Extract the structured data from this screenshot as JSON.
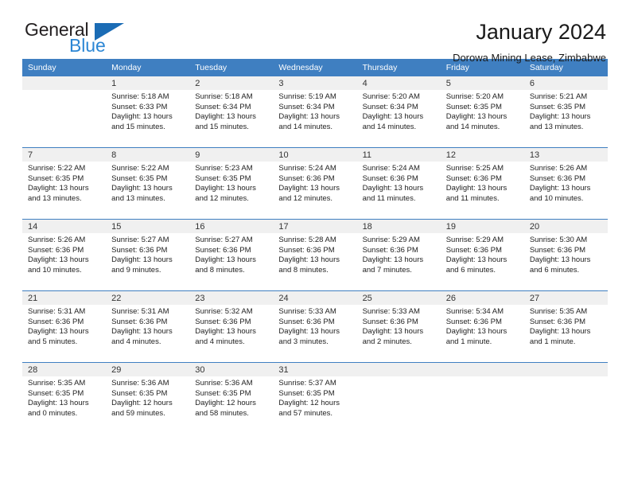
{
  "brand": {
    "name_part1": "General",
    "name_part2": "Blue",
    "triangle_icon": "triangle-icon",
    "accent_dark": "#231f20",
    "accent_blue": "#2b86d4",
    "triangle_blue": "#1b6cb5"
  },
  "header": {
    "title": "January 2024",
    "subtitle": "Dorowa Mining Lease, Zimbabwe"
  },
  "calendar": {
    "header_bg": "#3f7fc1",
    "daynum_bg": "#f0f0f0",
    "weekday_headers": [
      "Sunday",
      "Monday",
      "Tuesday",
      "Wednesday",
      "Thursday",
      "Friday",
      "Saturday"
    ],
    "weeks": [
      [
        {
          "day": "",
          "empty": true,
          "sunrise": "",
          "sunset": "",
          "daylight1": "",
          "daylight2": ""
        },
        {
          "day": "1",
          "sunrise": "Sunrise: 5:18 AM",
          "sunset": "Sunset: 6:33 PM",
          "daylight1": "Daylight: 13 hours",
          "daylight2": "and 15 minutes."
        },
        {
          "day": "2",
          "sunrise": "Sunrise: 5:18 AM",
          "sunset": "Sunset: 6:34 PM",
          "daylight1": "Daylight: 13 hours",
          "daylight2": "and 15 minutes."
        },
        {
          "day": "3",
          "sunrise": "Sunrise: 5:19 AM",
          "sunset": "Sunset: 6:34 PM",
          "daylight1": "Daylight: 13 hours",
          "daylight2": "and 14 minutes."
        },
        {
          "day": "4",
          "sunrise": "Sunrise: 5:20 AM",
          "sunset": "Sunset: 6:34 PM",
          "daylight1": "Daylight: 13 hours",
          "daylight2": "and 14 minutes."
        },
        {
          "day": "5",
          "sunrise": "Sunrise: 5:20 AM",
          "sunset": "Sunset: 6:35 PM",
          "daylight1": "Daylight: 13 hours",
          "daylight2": "and 14 minutes."
        },
        {
          "day": "6",
          "sunrise": "Sunrise: 5:21 AM",
          "sunset": "Sunset: 6:35 PM",
          "daylight1": "Daylight: 13 hours",
          "daylight2": "and 13 minutes."
        }
      ],
      [
        {
          "day": "7",
          "sunrise": "Sunrise: 5:22 AM",
          "sunset": "Sunset: 6:35 PM",
          "daylight1": "Daylight: 13 hours",
          "daylight2": "and 13 minutes."
        },
        {
          "day": "8",
          "sunrise": "Sunrise: 5:22 AM",
          "sunset": "Sunset: 6:35 PM",
          "daylight1": "Daylight: 13 hours",
          "daylight2": "and 13 minutes."
        },
        {
          "day": "9",
          "sunrise": "Sunrise: 5:23 AM",
          "sunset": "Sunset: 6:35 PM",
          "daylight1": "Daylight: 13 hours",
          "daylight2": "and 12 minutes."
        },
        {
          "day": "10",
          "sunrise": "Sunrise: 5:24 AM",
          "sunset": "Sunset: 6:36 PM",
          "daylight1": "Daylight: 13 hours",
          "daylight2": "and 12 minutes."
        },
        {
          "day": "11",
          "sunrise": "Sunrise: 5:24 AM",
          "sunset": "Sunset: 6:36 PM",
          "daylight1": "Daylight: 13 hours",
          "daylight2": "and 11 minutes."
        },
        {
          "day": "12",
          "sunrise": "Sunrise: 5:25 AM",
          "sunset": "Sunset: 6:36 PM",
          "daylight1": "Daylight: 13 hours",
          "daylight2": "and 11 minutes."
        },
        {
          "day": "13",
          "sunrise": "Sunrise: 5:26 AM",
          "sunset": "Sunset: 6:36 PM",
          "daylight1": "Daylight: 13 hours",
          "daylight2": "and 10 minutes."
        }
      ],
      [
        {
          "day": "14",
          "sunrise": "Sunrise: 5:26 AM",
          "sunset": "Sunset: 6:36 PM",
          "daylight1": "Daylight: 13 hours",
          "daylight2": "and 10 minutes."
        },
        {
          "day": "15",
          "sunrise": "Sunrise: 5:27 AM",
          "sunset": "Sunset: 6:36 PM",
          "daylight1": "Daylight: 13 hours",
          "daylight2": "and 9 minutes."
        },
        {
          "day": "16",
          "sunrise": "Sunrise: 5:27 AM",
          "sunset": "Sunset: 6:36 PM",
          "daylight1": "Daylight: 13 hours",
          "daylight2": "and 8 minutes."
        },
        {
          "day": "17",
          "sunrise": "Sunrise: 5:28 AM",
          "sunset": "Sunset: 6:36 PM",
          "daylight1": "Daylight: 13 hours",
          "daylight2": "and 8 minutes."
        },
        {
          "day": "18",
          "sunrise": "Sunrise: 5:29 AM",
          "sunset": "Sunset: 6:36 PM",
          "daylight1": "Daylight: 13 hours",
          "daylight2": "and 7 minutes."
        },
        {
          "day": "19",
          "sunrise": "Sunrise: 5:29 AM",
          "sunset": "Sunset: 6:36 PM",
          "daylight1": "Daylight: 13 hours",
          "daylight2": "and 6 minutes."
        },
        {
          "day": "20",
          "sunrise": "Sunrise: 5:30 AM",
          "sunset": "Sunset: 6:36 PM",
          "daylight1": "Daylight: 13 hours",
          "daylight2": "and 6 minutes."
        }
      ],
      [
        {
          "day": "21",
          "sunrise": "Sunrise: 5:31 AM",
          "sunset": "Sunset: 6:36 PM",
          "daylight1": "Daylight: 13 hours",
          "daylight2": "and 5 minutes."
        },
        {
          "day": "22",
          "sunrise": "Sunrise: 5:31 AM",
          "sunset": "Sunset: 6:36 PM",
          "daylight1": "Daylight: 13 hours",
          "daylight2": "and 4 minutes."
        },
        {
          "day": "23",
          "sunrise": "Sunrise: 5:32 AM",
          "sunset": "Sunset: 6:36 PM",
          "daylight1": "Daylight: 13 hours",
          "daylight2": "and 4 minutes."
        },
        {
          "day": "24",
          "sunrise": "Sunrise: 5:33 AM",
          "sunset": "Sunset: 6:36 PM",
          "daylight1": "Daylight: 13 hours",
          "daylight2": "and 3 minutes."
        },
        {
          "day": "25",
          "sunrise": "Sunrise: 5:33 AM",
          "sunset": "Sunset: 6:36 PM",
          "daylight1": "Daylight: 13 hours",
          "daylight2": "and 2 minutes."
        },
        {
          "day": "26",
          "sunrise": "Sunrise: 5:34 AM",
          "sunset": "Sunset: 6:36 PM",
          "daylight1": "Daylight: 13 hours",
          "daylight2": "and 1 minute."
        },
        {
          "day": "27",
          "sunrise": "Sunrise: 5:35 AM",
          "sunset": "Sunset: 6:36 PM",
          "daylight1": "Daylight: 13 hours",
          "daylight2": "and 1 minute."
        }
      ],
      [
        {
          "day": "28",
          "sunrise": "Sunrise: 5:35 AM",
          "sunset": "Sunset: 6:35 PM",
          "daylight1": "Daylight: 13 hours",
          "daylight2": "and 0 minutes."
        },
        {
          "day": "29",
          "sunrise": "Sunrise: 5:36 AM",
          "sunset": "Sunset: 6:35 PM",
          "daylight1": "Daylight: 12 hours",
          "daylight2": "and 59 minutes."
        },
        {
          "day": "30",
          "sunrise": "Sunrise: 5:36 AM",
          "sunset": "Sunset: 6:35 PM",
          "daylight1": "Daylight: 12 hours",
          "daylight2": "and 58 minutes."
        },
        {
          "day": "31",
          "sunrise": "Sunrise: 5:37 AM",
          "sunset": "Sunset: 6:35 PM",
          "daylight1": "Daylight: 12 hours",
          "daylight2": "and 57 minutes."
        },
        {
          "day": "",
          "empty": true,
          "sunrise": "",
          "sunset": "",
          "daylight1": "",
          "daylight2": ""
        },
        {
          "day": "",
          "empty": true,
          "sunrise": "",
          "sunset": "",
          "daylight1": "",
          "daylight2": ""
        },
        {
          "day": "",
          "empty": true,
          "sunrise": "",
          "sunset": "",
          "daylight1": "",
          "daylight2": ""
        }
      ]
    ]
  }
}
